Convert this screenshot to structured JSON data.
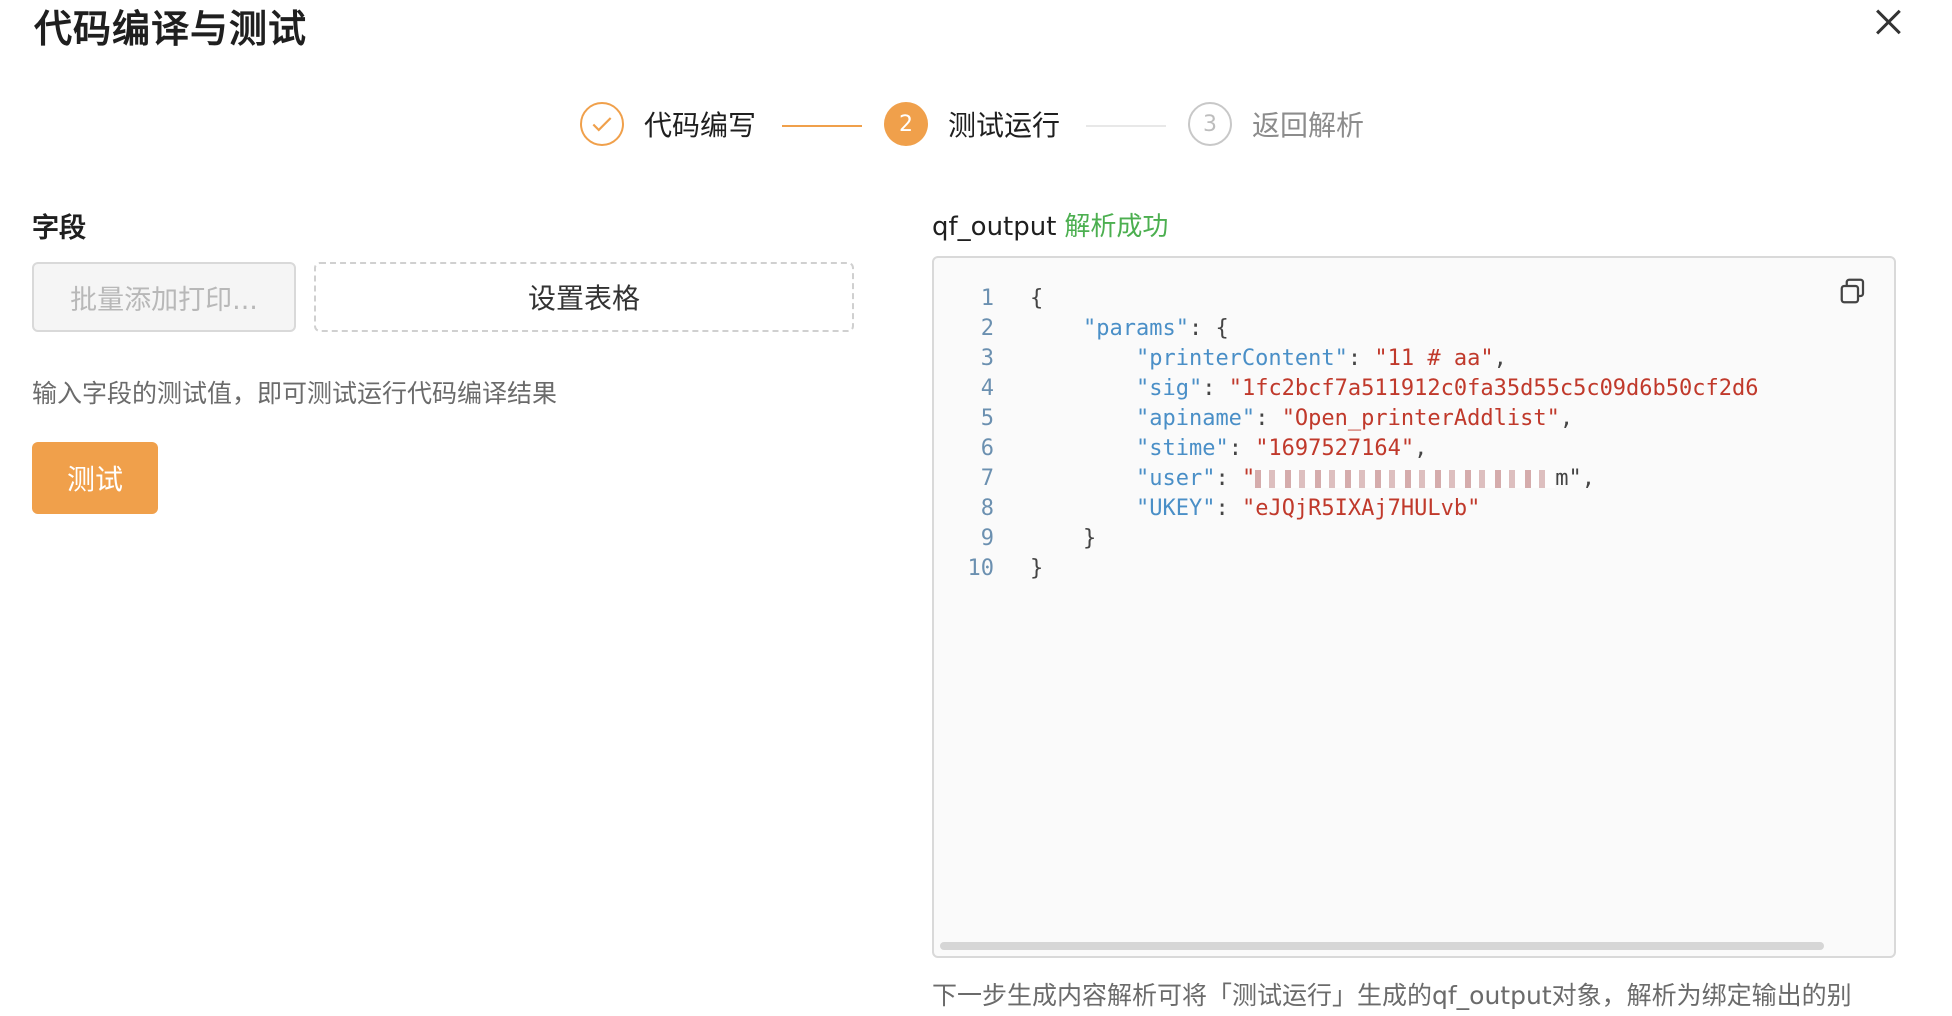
{
  "dialog": {
    "title": "代码编译与测试"
  },
  "steps": [
    {
      "num": "",
      "label": "代码编写",
      "state": "done"
    },
    {
      "num": "2",
      "label": "测试运行",
      "state": "active"
    },
    {
      "num": "3",
      "label": "返回解析",
      "state": "pending"
    }
  ],
  "left": {
    "field_label": "字段",
    "batch_placeholder": "批量添加打印...",
    "set_table": "设置表格",
    "hint": "输入字段的测试值，即可测试运行代码编译结果",
    "test_button": "测试"
  },
  "right": {
    "output_name": "qf_output",
    "status": "解析成功",
    "code_lines": [
      {
        "n": "1",
        "indent": "",
        "key": "",
        "value": "",
        "punct": "{"
      },
      {
        "n": "2",
        "indent": "    ",
        "key": "\"params\"",
        "value": "",
        "punct": ": {"
      },
      {
        "n": "3",
        "indent": "        ",
        "key": "\"printerContent\"",
        "value": "\"11 # aa\"",
        "punct": ","
      },
      {
        "n": "4",
        "indent": "        ",
        "key": "\"sig\"",
        "value": "\"1fc2bcf7a511912c0fa35d55c5c09d6b50cf2d6",
        "punct": ""
      },
      {
        "n": "5",
        "indent": "        ",
        "key": "\"apiname\"",
        "value": "\"Open_printerAddlist\"",
        "punct": ","
      },
      {
        "n": "6",
        "indent": "        ",
        "key": "\"stime\"",
        "value": "\"1697527164\"",
        "punct": ","
      },
      {
        "n": "7",
        "indent": "        ",
        "key": "\"user\"",
        "value": "\"",
        "punct": "m\","
      },
      {
        "n": "8",
        "indent": "        ",
        "key": "\"UKEY\"",
        "value": "\"eJQjR5IXAj7HULvb\"",
        "punct": ""
      },
      {
        "n": "9",
        "indent": "    ",
        "key": "",
        "value": "",
        "punct": "}"
      },
      {
        "n": "10",
        "indent": "",
        "key": "",
        "value": "",
        "punct": "}"
      }
    ]
  },
  "footer": "下一步生成内容解析可将「测试运行」生成的qf_output对象，解析为绑定输出的别"
}
